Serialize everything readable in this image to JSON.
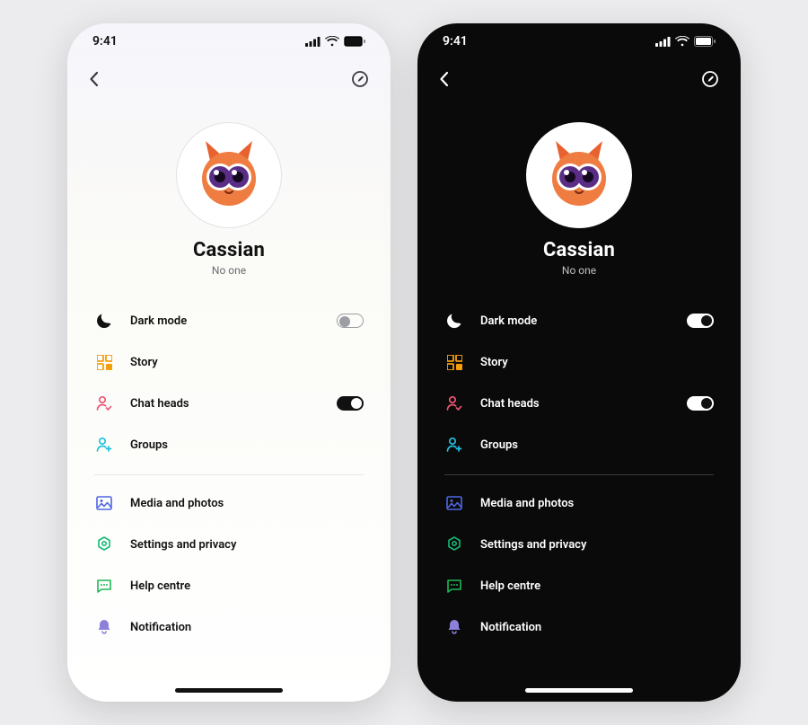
{
  "status": {
    "time": "9:41"
  },
  "profile": {
    "name": "Cassian",
    "subtitle": "No one"
  },
  "menu": {
    "dark_mode": {
      "label": "Dark mode",
      "state_light": "off",
      "state_dark": "on"
    },
    "story": {
      "label": "Story"
    },
    "chat_heads": {
      "label": "Chat heads",
      "state": "on"
    },
    "groups": {
      "label": "Groups"
    },
    "media": {
      "label": "Media and photos"
    },
    "settings": {
      "label": "Settings and privacy"
    },
    "help": {
      "label": "Help centre"
    },
    "notification": {
      "label": "Notification"
    }
  },
  "colors": {
    "story_icon": "#f59e0b",
    "chat_heads_icon": "#f05672",
    "groups_icon": "#23c0df",
    "media_icon": "#4f66e3",
    "settings_icon": "#15b976",
    "help_icon": "#1db954",
    "notification_icon": "#8c81d9"
  }
}
